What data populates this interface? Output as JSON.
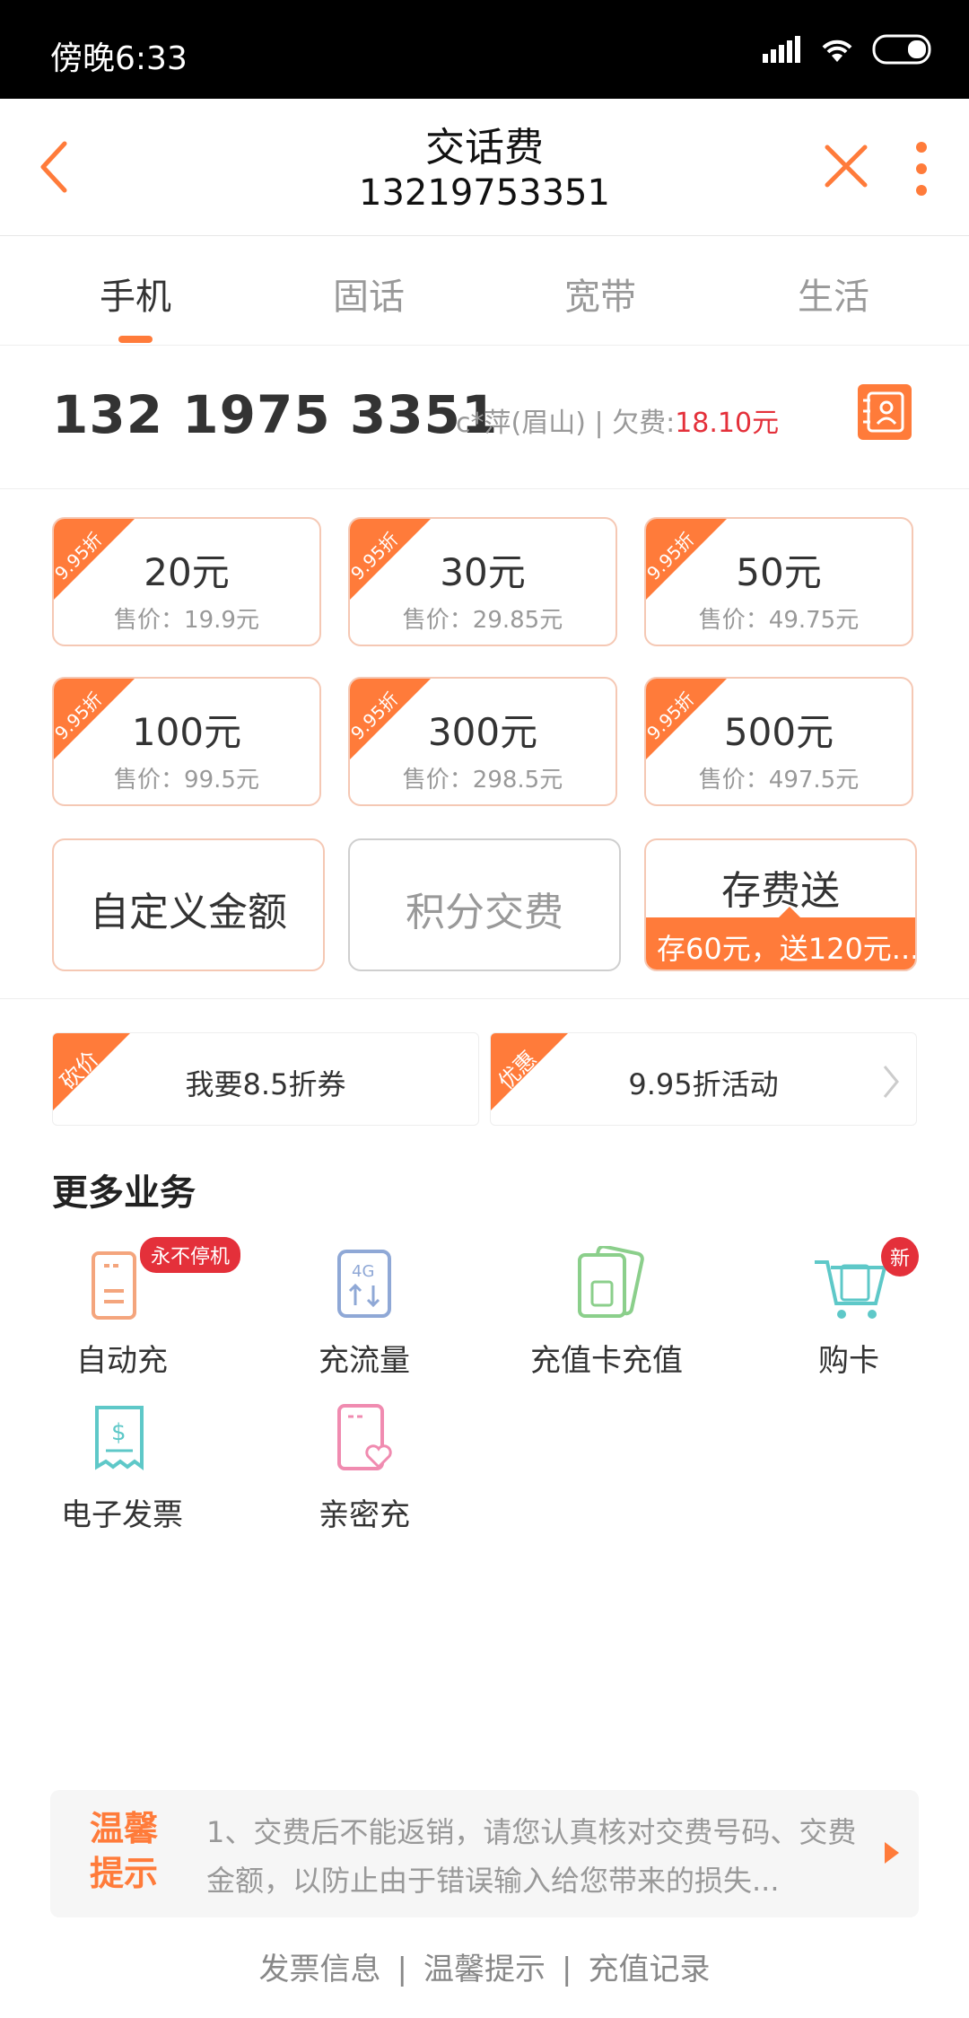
{
  "status_bar": {
    "time": "傍晚6:33"
  },
  "nav": {
    "title": "交话费",
    "subtitle": "13219753351"
  },
  "tabs": [
    {
      "label": "手机"
    },
    {
      "label": "固话"
    },
    {
      "label": "宽带"
    },
    {
      "label": "生活"
    }
  ],
  "account": {
    "number": "132 1975 3351",
    "owner": "c*萍(眉山) | 欠费:",
    "debt": "18.10元"
  },
  "recharge": [
    {
      "discount": "9.95折",
      "amount": "20元",
      "price": "售价：19.9元"
    },
    {
      "discount": "9.95折",
      "amount": "30元",
      "price": "售价：29.85元"
    },
    {
      "discount": "9.95折",
      "amount": "50元",
      "price": "售价：49.75元"
    },
    {
      "discount": "9.95折",
      "amount": "100元",
      "price": "售价：99.5元"
    },
    {
      "discount": "9.95折",
      "amount": "300元",
      "price": "售价：298.5元"
    },
    {
      "discount": "9.95折",
      "amount": "500元",
      "price": "售价：497.5元"
    }
  ],
  "actions": {
    "custom": "自定义金额",
    "points": "积分交费",
    "deposit": "存费送",
    "deposit_sub": "存60元，送120元..."
  },
  "promos": [
    {
      "tag": "砍价",
      "text": "我要8.5折券"
    },
    {
      "tag": "优惠",
      "text": "9.95折活动"
    }
  ],
  "more_title": "更多业务",
  "services": [
    {
      "label": "自动充",
      "badge": "永不停机",
      "icon": "auto-recharge-icon"
    },
    {
      "label": "充流量",
      "icon": "data-4g-icon"
    },
    {
      "label": "充值卡充值",
      "icon": "sim-card-icon"
    },
    {
      "label": "购卡",
      "badge": "新",
      "icon": "cart-icon"
    },
    {
      "label": "电子发票",
      "icon": "invoice-icon"
    },
    {
      "label": "亲密充",
      "icon": "heart-phone-icon"
    }
  ],
  "tips": {
    "head": "温馨提示",
    "body": "1、交费后不能返销，请您认真核对交费号码、交费金额，以防止由于错误输入给您带来的损失..."
  },
  "footer": [
    "发票信息",
    "温馨提示",
    "充值记录"
  ],
  "colors": {
    "accent": "#ff7b3a",
    "danger": "#e4303a"
  }
}
